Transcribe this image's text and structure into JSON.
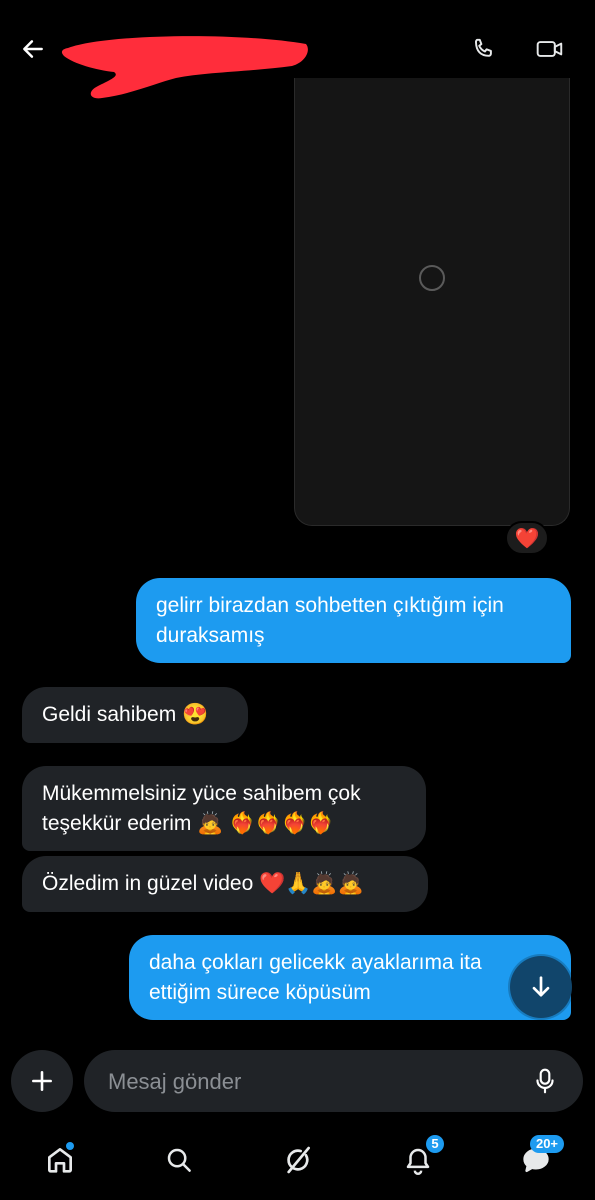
{
  "header": {
    "back_icon": "arrow-left-icon",
    "call_icon": "phone-icon",
    "video_icon": "video-camera-icon",
    "redaction_color": "#ff2d3b"
  },
  "media": {
    "spinner_icon": "loading-circle-icon",
    "reaction": "❤️"
  },
  "messages": [
    {
      "direction": "outgoing",
      "text": "gelirr birazdan sohbetten çıktığım için\nduraksamış"
    },
    {
      "direction": "incoming",
      "text": "Geldi sahibem 😍"
    },
    {
      "direction": "incoming",
      "text": "Mükemmelsiniz yüce sahibem çok\nteşekkür ederim 🙇 ❤️‍🔥❤️‍🔥❤️‍🔥❤️‍🔥"
    },
    {
      "direction": "incoming",
      "text": "Özledim in güzel video ❤️🙏🙇🙇"
    },
    {
      "direction": "outgoing",
      "text": "daha çokları gelicekk ayaklarıma ita\nettiğim sürece köpüsüm"
    }
  ],
  "composer": {
    "placeholder": "Mesaj gönder",
    "plus_icon": "plus-icon",
    "mic_icon": "microphone-icon"
  },
  "bottom_nav": {
    "items": [
      {
        "name": "home",
        "icon": "home-icon"
      },
      {
        "name": "search",
        "icon": "search-icon"
      },
      {
        "name": "grok",
        "icon": "grok-icon"
      },
      {
        "name": "notifications",
        "icon": "bell-icon",
        "badge": "5"
      },
      {
        "name": "messages",
        "icon": "messages-icon",
        "badge": "20+"
      }
    ]
  },
  "colors": {
    "accent": "#1d9bf0",
    "incoming_bubble": "#202327",
    "background": "#000000"
  }
}
